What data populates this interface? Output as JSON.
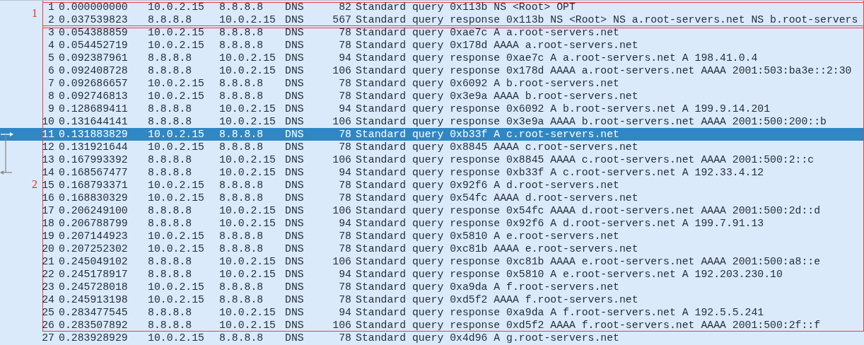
{
  "packets": [
    {
      "no": "1",
      "time": "0.000000000",
      "source": "10.0.2.15",
      "destination": "8.8.8.8",
      "protocol": "DNS",
      "length": "82",
      "info": "Standard query 0x113b NS <Root> OPT",
      "selected": false,
      "framed": true,
      "frame_start": true,
      "related": false
    },
    {
      "no": "2",
      "time": "0.037539823",
      "source": "8.8.8.8",
      "destination": "10.0.2.15",
      "protocol": "DNS",
      "length": "567",
      "info": "Standard query response 0x113b NS <Root> NS a.root-servers.net NS b.root-servers",
      "selected": false,
      "framed": true,
      "frame_start": false,
      "related": false
    },
    {
      "no": "3",
      "time": "0.054388859",
      "source": "10.0.2.15",
      "destination": "8.8.8.8",
      "protocol": "DNS",
      "length": "78",
      "info": "Standard query 0xae7c A a.root-servers.net",
      "selected": false,
      "framed": true,
      "frame_start": true,
      "related": false
    },
    {
      "no": "4",
      "time": "0.054452719",
      "source": "10.0.2.15",
      "destination": "8.8.8.8",
      "protocol": "DNS",
      "length": "78",
      "info": "Standard query 0x178d AAAA a.root-servers.net",
      "selected": false,
      "framed": true,
      "frame_start": false,
      "related": false
    },
    {
      "no": "5",
      "time": "0.092387961",
      "source": "8.8.8.8",
      "destination": "10.0.2.15",
      "protocol": "DNS",
      "length": "94",
      "info": "Standard query response 0xae7c A a.root-servers.net A 198.41.0.4",
      "selected": false,
      "framed": true,
      "frame_start": false,
      "related": false
    },
    {
      "no": "6",
      "time": "0.092408728",
      "source": "8.8.8.8",
      "destination": "10.0.2.15",
      "protocol": "DNS",
      "length": "106",
      "info": "Standard query response 0x178d AAAA a.root-servers.net AAAA 2001:503:ba3e::2:30",
      "selected": false,
      "framed": true,
      "frame_start": false,
      "related": false
    },
    {
      "no": "7",
      "time": "0.092686657",
      "source": "10.0.2.15",
      "destination": "8.8.8.8",
      "protocol": "DNS",
      "length": "78",
      "info": "Standard query 0x6092 A b.root-servers.net",
      "selected": false,
      "framed": true,
      "frame_start": false,
      "related": false
    },
    {
      "no": "8",
      "time": "0.092746813",
      "source": "10.0.2.15",
      "destination": "8.8.8.8",
      "protocol": "DNS",
      "length": "78",
      "info": "Standard query 0x3e9a AAAA b.root-servers.net",
      "selected": false,
      "framed": true,
      "frame_start": false,
      "related": false
    },
    {
      "no": "9",
      "time": "0.128689411",
      "source": "8.8.8.8",
      "destination": "10.0.2.15",
      "protocol": "DNS",
      "length": "94",
      "info": "Standard query response 0x6092 A b.root-servers.net A 199.9.14.201",
      "selected": false,
      "framed": true,
      "frame_start": false,
      "related": false
    },
    {
      "no": "10",
      "time": "0.131644141",
      "source": "8.8.8.8",
      "destination": "10.0.2.15",
      "protocol": "DNS",
      "length": "106",
      "info": "Standard query response 0x3e9a AAAA b.root-servers.net AAAA 2001:500:200::b",
      "selected": false,
      "framed": true,
      "frame_start": false,
      "related": false
    },
    {
      "no": "11",
      "time": "0.131883829",
      "source": "10.0.2.15",
      "destination": "8.8.8.8",
      "protocol": "DNS",
      "length": "78",
      "info": "Standard query 0xb33f A c.root-servers.net",
      "selected": true,
      "framed": true,
      "frame_start": false,
      "related": true
    },
    {
      "no": "12",
      "time": "0.131921644",
      "source": "10.0.2.15",
      "destination": "8.8.8.8",
      "protocol": "DNS",
      "length": "78",
      "info": "Standard query 0x8845 AAAA c.root-servers.net",
      "selected": false,
      "framed": true,
      "frame_start": false,
      "related": false
    },
    {
      "no": "13",
      "time": "0.167993392",
      "source": "8.8.8.8",
      "destination": "10.0.2.15",
      "protocol": "DNS",
      "length": "106",
      "info": "Standard query response 0x8845 AAAA c.root-servers.net AAAA 2001:500:2::c",
      "selected": false,
      "framed": true,
      "frame_start": false,
      "related": false
    },
    {
      "no": "14",
      "time": "0.168567477",
      "source": "8.8.8.8",
      "destination": "10.0.2.15",
      "protocol": "DNS",
      "length": "94",
      "info": "Standard query response 0xb33f A c.root-servers.net A 192.33.4.12",
      "selected": false,
      "framed": true,
      "frame_start": false,
      "related": true
    },
    {
      "no": "15",
      "time": "0.168793371",
      "source": "10.0.2.15",
      "destination": "8.8.8.8",
      "protocol": "DNS",
      "length": "78",
      "info": "Standard query 0x92f6 A d.root-servers.net",
      "selected": false,
      "framed": true,
      "frame_start": false,
      "related": false
    },
    {
      "no": "16",
      "time": "0.168830329",
      "source": "10.0.2.15",
      "destination": "8.8.8.8",
      "protocol": "DNS",
      "length": "78",
      "info": "Standard query 0x54fc AAAA d.root-servers.net",
      "selected": false,
      "framed": true,
      "frame_start": false,
      "related": false
    },
    {
      "no": "17",
      "time": "0.206249100",
      "source": "8.8.8.8",
      "destination": "10.0.2.15",
      "protocol": "DNS",
      "length": "106",
      "info": "Standard query response 0x54fc AAAA d.root-servers.net AAAA 2001:500:2d::d",
      "selected": false,
      "framed": true,
      "frame_start": false,
      "related": false
    },
    {
      "no": "18",
      "time": "0.206788799",
      "source": "8.8.8.8",
      "destination": "10.0.2.15",
      "protocol": "DNS",
      "length": "94",
      "info": "Standard query response 0x92f6 A d.root-servers.net A 199.7.91.13",
      "selected": false,
      "framed": true,
      "frame_start": false,
      "related": false
    },
    {
      "no": "19",
      "time": "0.207144923",
      "source": "10.0.2.15",
      "destination": "8.8.8.8",
      "protocol": "DNS",
      "length": "78",
      "info": "Standard query 0x5810 A e.root-servers.net",
      "selected": false,
      "framed": true,
      "frame_start": false,
      "related": false
    },
    {
      "no": "20",
      "time": "0.207252302",
      "source": "10.0.2.15",
      "destination": "8.8.8.8",
      "protocol": "DNS",
      "length": "78",
      "info": "Standard query 0xc81b AAAA e.root-servers.net",
      "selected": false,
      "framed": true,
      "frame_start": false,
      "related": false
    },
    {
      "no": "21",
      "time": "0.245049102",
      "source": "8.8.8.8",
      "destination": "10.0.2.15",
      "protocol": "DNS",
      "length": "106",
      "info": "Standard query response 0xc81b AAAA e.root-servers.net AAAA 2001:500:a8::e",
      "selected": false,
      "framed": true,
      "frame_start": false,
      "related": false
    },
    {
      "no": "22",
      "time": "0.245178917",
      "source": "8.8.8.8",
      "destination": "10.0.2.15",
      "protocol": "DNS",
      "length": "94",
      "info": "Standard query response 0x5810 A e.root-servers.net A 192.203.230.10",
      "selected": false,
      "framed": true,
      "frame_start": false,
      "related": false
    },
    {
      "no": "23",
      "time": "0.245728018",
      "source": "10.0.2.15",
      "destination": "8.8.8.8",
      "protocol": "DNS",
      "length": "78",
      "info": "Standard query 0xa9da A f.root-servers.net",
      "selected": false,
      "framed": true,
      "frame_start": false,
      "related": false
    },
    {
      "no": "24",
      "time": "0.245913198",
      "source": "10.0.2.15",
      "destination": "8.8.8.8",
      "protocol": "DNS",
      "length": "78",
      "info": "Standard query 0xd5f2 AAAA f.root-servers.net",
      "selected": false,
      "framed": true,
      "frame_start": false,
      "related": false
    },
    {
      "no": "25",
      "time": "0.283477545",
      "source": "8.8.8.8",
      "destination": "10.0.2.15",
      "protocol": "DNS",
      "length": "94",
      "info": "Standard query response 0xa9da A f.root-servers.net A 192.5.5.241",
      "selected": false,
      "framed": true,
      "frame_start": false,
      "related": false
    },
    {
      "no": "26",
      "time": "0.283507892",
      "source": "8.8.8.8",
      "destination": "10.0.2.15",
      "protocol": "DNS",
      "length": "106",
      "info": "Standard query response 0xd5f2 AAAA f.root-servers.net AAAA 2001:500:2f::f",
      "selected": false,
      "framed": true,
      "frame_start": false,
      "related": false
    },
    {
      "no": "27",
      "time": "0.283928929",
      "source": "10.0.2.15",
      "destination": "8.8.8.8",
      "protocol": "DNS",
      "length": "78",
      "info": "Standard query 0x4d96 A g.root-servers.net",
      "selected": false,
      "framed": false,
      "frame_start": false,
      "related": false
    }
  ],
  "annotations": [
    {
      "label": "1"
    },
    {
      "label": "2"
    }
  ]
}
